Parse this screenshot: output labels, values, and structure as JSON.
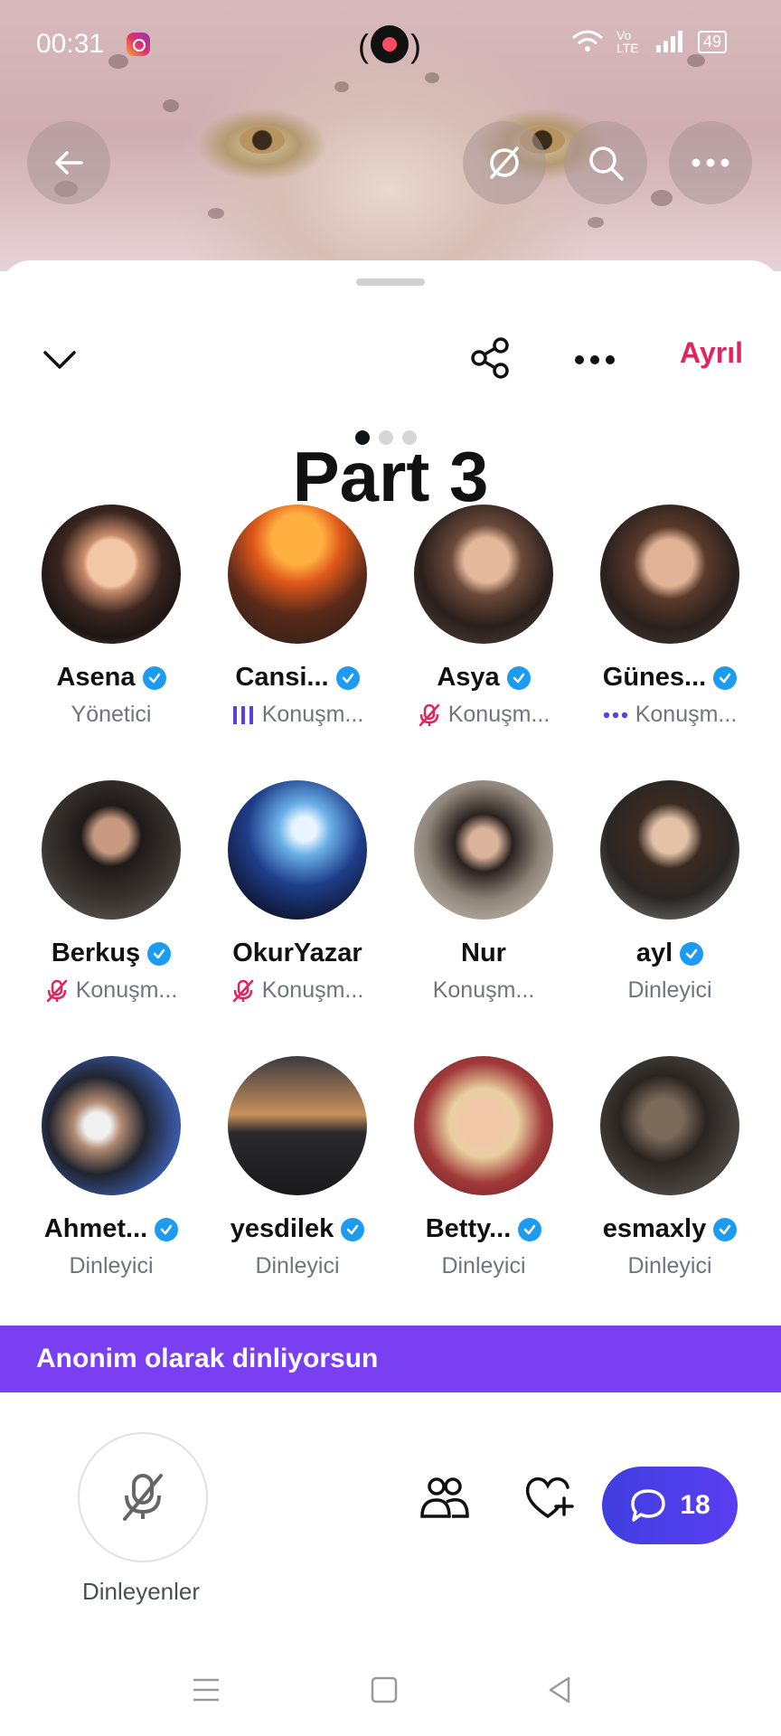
{
  "status_bar": {
    "time": "00:31",
    "network_label": "Vo LTE",
    "battery": "49"
  },
  "hero": {
    "icons": [
      "back-arrow-icon",
      "disabled-link-icon",
      "search-icon",
      "more-icon"
    ]
  },
  "sheet_toolbar": {
    "collapse_icon": "chevron-down-icon",
    "share_icon": "share-icon",
    "more_icon": "more-icon",
    "leave_label": "Ayrıl"
  },
  "pager": {
    "count": 3,
    "active": 0
  },
  "overlay_caption": "Part 3",
  "participants": [
    {
      "name": "Asena",
      "verified": true,
      "role": "Yönetici",
      "role_icon": "none"
    },
    {
      "name": "Cansi...",
      "verified": true,
      "role": "Konuşm...",
      "role_icon": "speaking-bars-icon"
    },
    {
      "name": "Asya",
      "verified": true,
      "role": "Konuşm...",
      "role_icon": "mic-muted-icon"
    },
    {
      "name": "Günes...",
      "verified": true,
      "role": "Konuşm...",
      "role_icon": "typing-dots-icon"
    },
    {
      "name": "Berkuş",
      "verified": true,
      "role": "Konuşm...",
      "role_icon": "mic-muted-icon"
    },
    {
      "name": "OkurYazar",
      "verified": false,
      "role": "Konuşm...",
      "role_icon": "mic-muted-icon"
    },
    {
      "name": "Nur",
      "verified": false,
      "role": "Konuşm...",
      "role_icon": "none"
    },
    {
      "name": "ayl",
      "verified": true,
      "role": "Dinleyici",
      "role_icon": "none"
    },
    {
      "name": "Ahmet...",
      "verified": true,
      "role": "Dinleyici",
      "role_icon": "none"
    },
    {
      "name": "yesdilek",
      "verified": true,
      "role": "Dinleyici",
      "role_icon": "none"
    },
    {
      "name": "Betty...",
      "verified": true,
      "role": "Dinleyici",
      "role_icon": "none"
    },
    {
      "name": "esmaxly",
      "verified": true,
      "role": "Dinleyici",
      "role_icon": "none"
    }
  ],
  "banner": {
    "text": "Anonim olarak dinliyorsun"
  },
  "bottom_bar": {
    "mic_label": "Dinleyenler",
    "chat_count": "18"
  },
  "colors": {
    "accent_purple": "#7b3ff2",
    "leave_red": "#e0245e",
    "verified_blue": "#1d9bf0",
    "chat_blue": "#4a3ee8",
    "muted_red": "#e0245e",
    "speaking_purple": "#5b3fe0"
  }
}
